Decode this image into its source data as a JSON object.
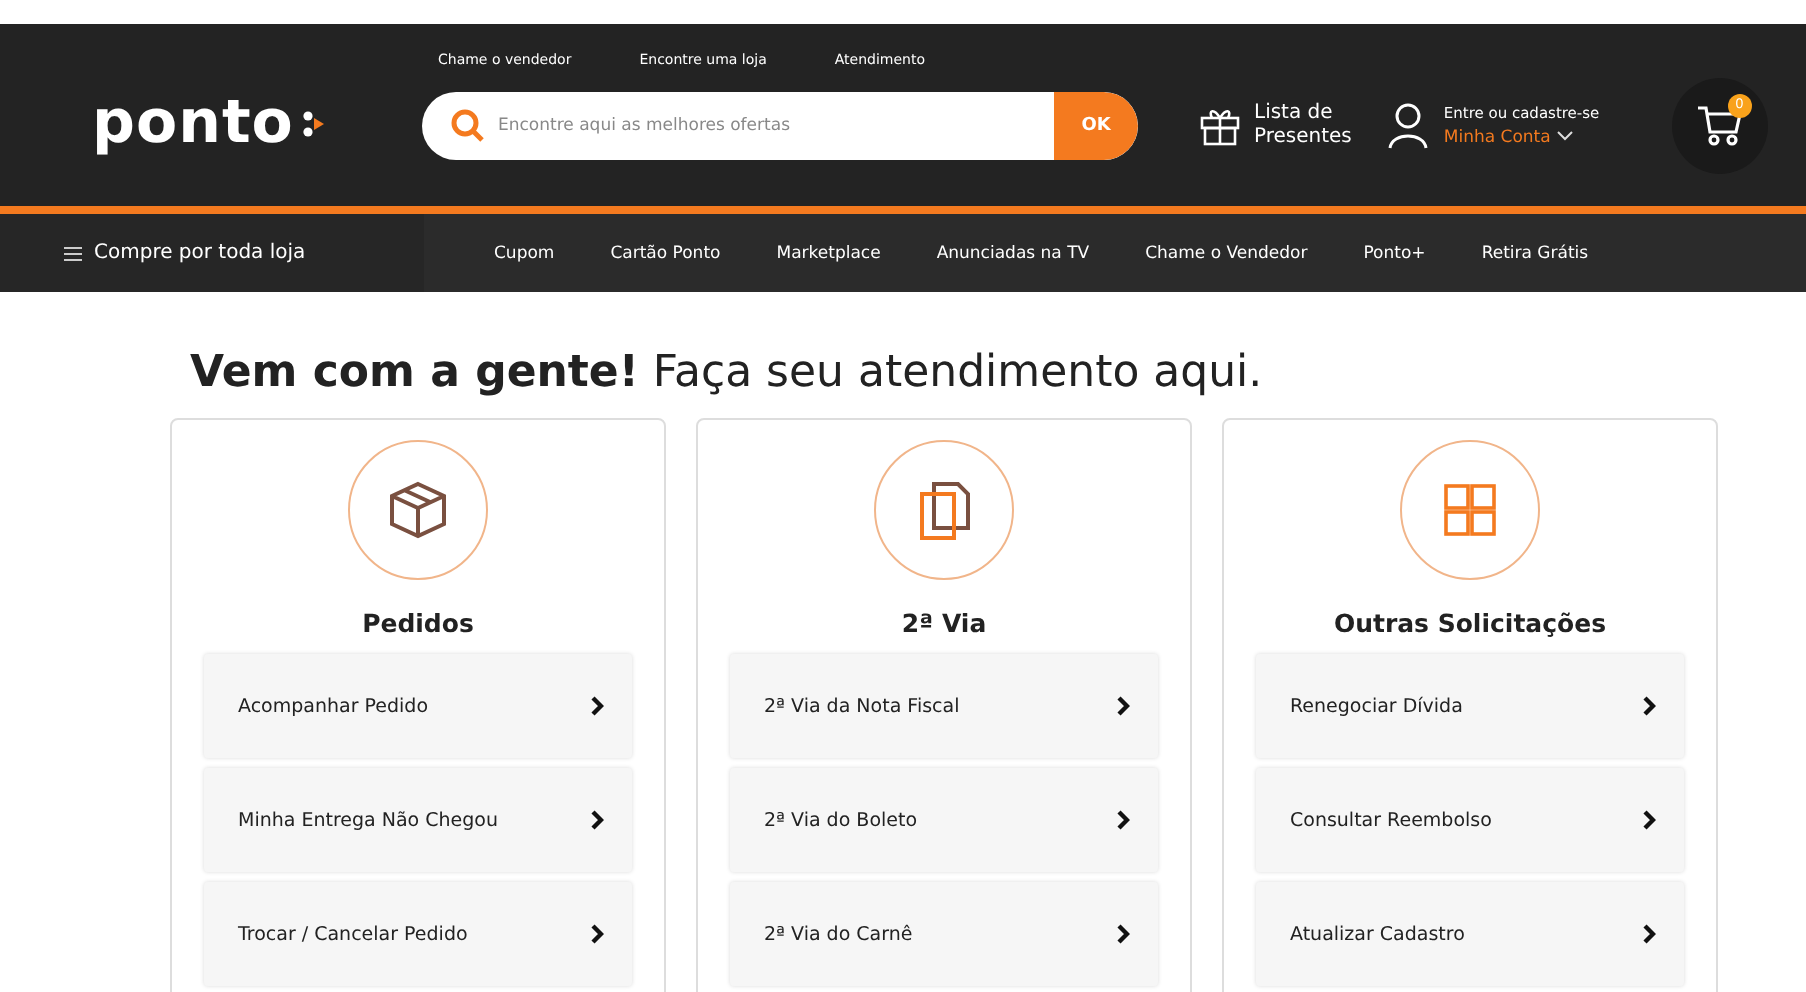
{
  "header": {
    "top_links": [
      "Chame o vendedor",
      "Encontre uma loja",
      "Atendimento"
    ],
    "logo": "ponto",
    "search": {
      "placeholder": "Encontre aqui as melhores ofertas",
      "button": "OK"
    },
    "gift_list": [
      "Lista de",
      "Presentes"
    ],
    "account": {
      "prompt": "Entre ou cadastre-se",
      "label": "Minha Conta"
    },
    "cart": {
      "count": "0"
    }
  },
  "nav": {
    "menu": "Compre por toda loja",
    "links": [
      "Cupom",
      "Cartão Ponto",
      "Marketplace",
      "Anunciadas na TV",
      "Chame o Vendedor",
      "Ponto+",
      "Retira Grátis"
    ]
  },
  "heading": {
    "bold": "Vem com a gente!",
    "rest": "Faça seu atendimento aqui."
  },
  "cards": [
    {
      "kind": "box",
      "title": "Pedidos",
      "items": [
        "Acompanhar Pedido",
        "Minha Entrega Não Chegou",
        "Trocar / Cancelar Pedido"
      ]
    },
    {
      "kind": "documents",
      "title": "2ª Via",
      "items": [
        "2ª Via da Nota Fiscal",
        "2ª Via do Boleto",
        "2ª Via do Carnê"
      ]
    },
    {
      "kind": "grid",
      "title": "Outras Solicitações",
      "items": [
        "Renegociar Dívida",
        "Consultar Reembolso",
        "Atualizar Cadastro"
      ]
    }
  ]
}
